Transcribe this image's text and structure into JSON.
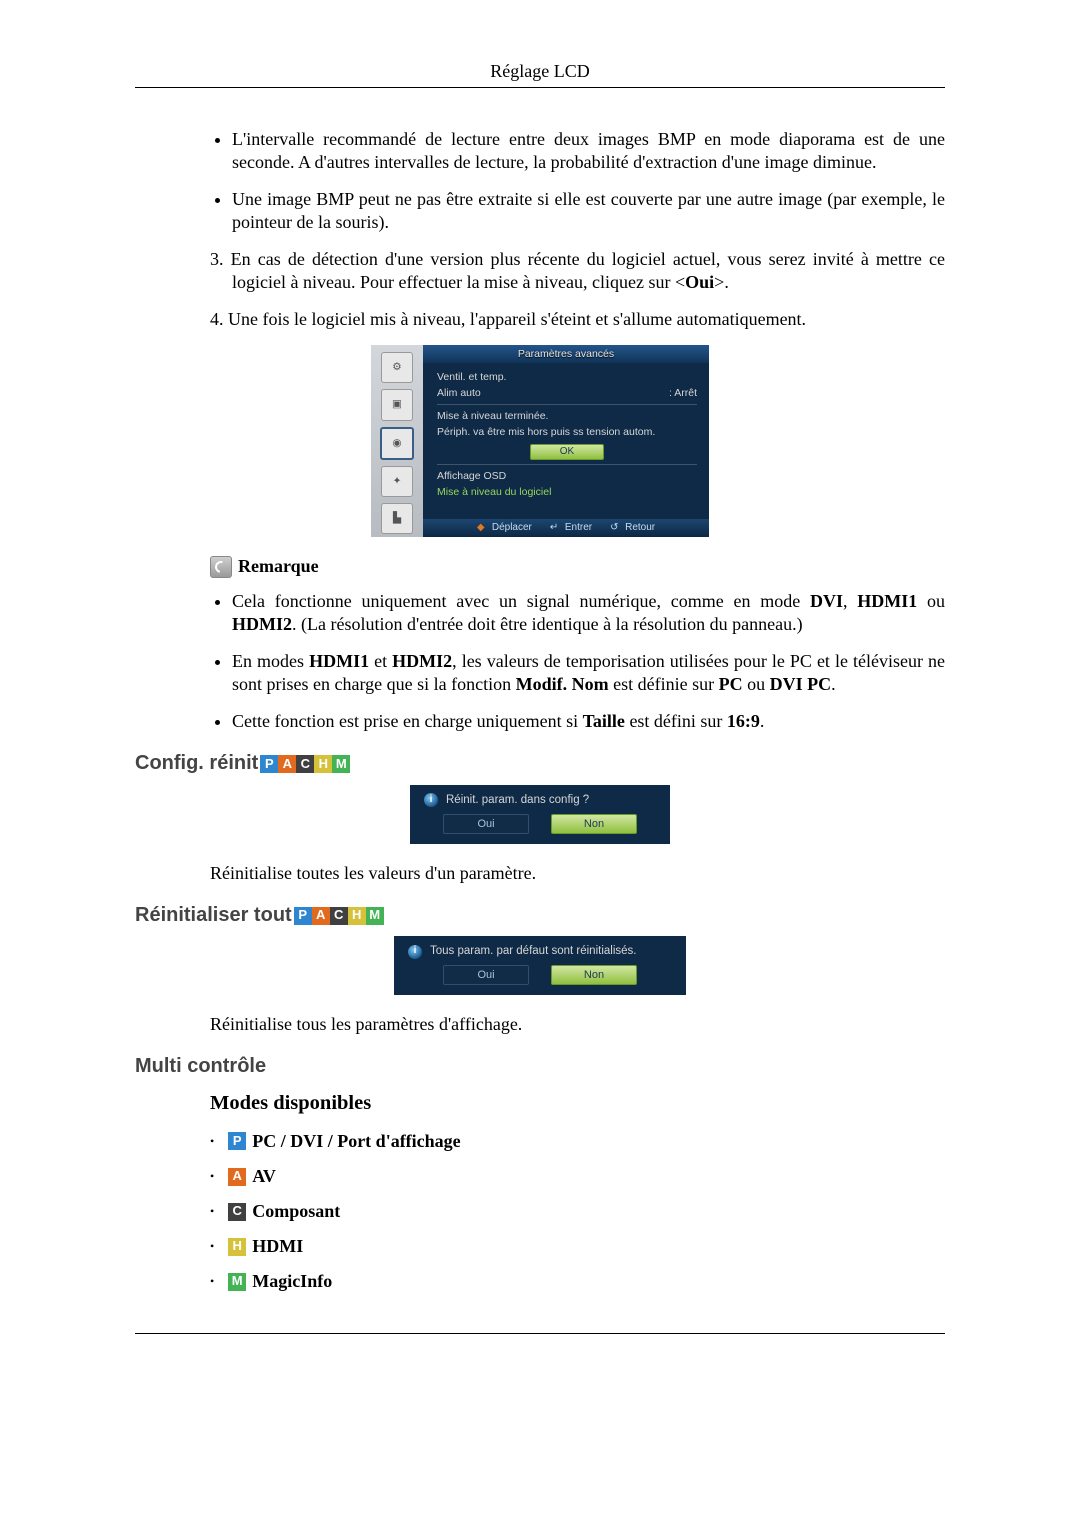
{
  "header": {
    "title": "Réglage LCD"
  },
  "intro_bullets": [
    "L'intervalle recommandé de lecture entre deux images BMP en mode diaporama est de une seconde. A d'autres intervalles de lecture, la probabilité d'extraction d'une image diminue.",
    "Une image BMP peut ne pas être extraite si elle est couverte par une autre image (par exemple, le pointeur de la souris)."
  ],
  "numbered": {
    "item3_a": "En cas de détection d'une version plus récente du logiciel actuel, vous serez invité à mettre ce logiciel à niveau. Pour effectuer la mise à niveau, cliquez sur <",
    "item3_b": "Oui",
    "item3_c": ">.",
    "item4": "Une fois le logiciel mis à niveau, l'appareil s'éteint et s'allume automatiquement."
  },
  "osd": {
    "title": "Paramètres avancés",
    "ventil": "Ventil. et temp.",
    "alim_label": "Alim auto",
    "alim_value": ": Arrêt",
    "upgrade_done": "Mise à niveau terminée.",
    "upgrade_msg": "Périph. va être mis hors puis ss tension autom.",
    "ok": "OK",
    "affichage": "Affichage OSD",
    "maj": "Mise à niveau du logiciel",
    "footer_move": "Déplacer",
    "footer_enter": "Entrer",
    "footer_return": "Retour"
  },
  "note": {
    "label": "Remarque"
  },
  "note_bullets": {
    "b1_a": "Cela fonctionne uniquement avec un signal numérique, comme en mode ",
    "b1_b": "DVI",
    "b1_c": "HDMI1",
    "b1_d": " ou ",
    "b1_e": "HDMI2",
    "b1_f": ". (La résolution d'entrée doit être identique à la résolution du panneau.)",
    "b2_a": "En modes ",
    "b2_b": "HDMI1",
    "b2_c": " et ",
    "b2_d": "HDMI2",
    "b2_e": ", les valeurs de temporisation utilisées pour le PC et le téléviseur ne sont prises en charge que si la fonction ",
    "b2_f": "Modif. Nom",
    "b2_g": " est définie sur ",
    "b2_h": "PC",
    "b2_i": " ou ",
    "b2_j": "DVI PC",
    "b2_k": ".",
    "b3_a": "Cette fonction est prise en charge uniquement si ",
    "b3_b": "Taille",
    "b3_c": " est défini sur ",
    "b3_d": "16:9",
    "b3_e": "."
  },
  "sections": {
    "config_reinit": "Config. réinit",
    "reset_all": "Réinitialiser tout",
    "multi": "Multi contrôle",
    "modes": "Modes disponibles"
  },
  "dlg1": {
    "q": "Réinit. param. dans config ?",
    "yes": "Oui",
    "no": "Non",
    "desc": "Réinitialise toutes les valeurs d'un paramètre."
  },
  "dlg2": {
    "q": "Tous param. par défaut sont réinitialisés.",
    "yes": "Oui",
    "no": "Non",
    "desc": "Réinitialise tous les paramètres d'affichage."
  },
  "badges": {
    "P": "P",
    "A": "A",
    "C": "C",
    "H": "H",
    "M": "M"
  },
  "modes": {
    "pc": "PC / DVI / Port d'affichage",
    "av": "AV",
    "comp": "Composant",
    "hdmi": "HDMI",
    "magic": "MagicInfo"
  }
}
